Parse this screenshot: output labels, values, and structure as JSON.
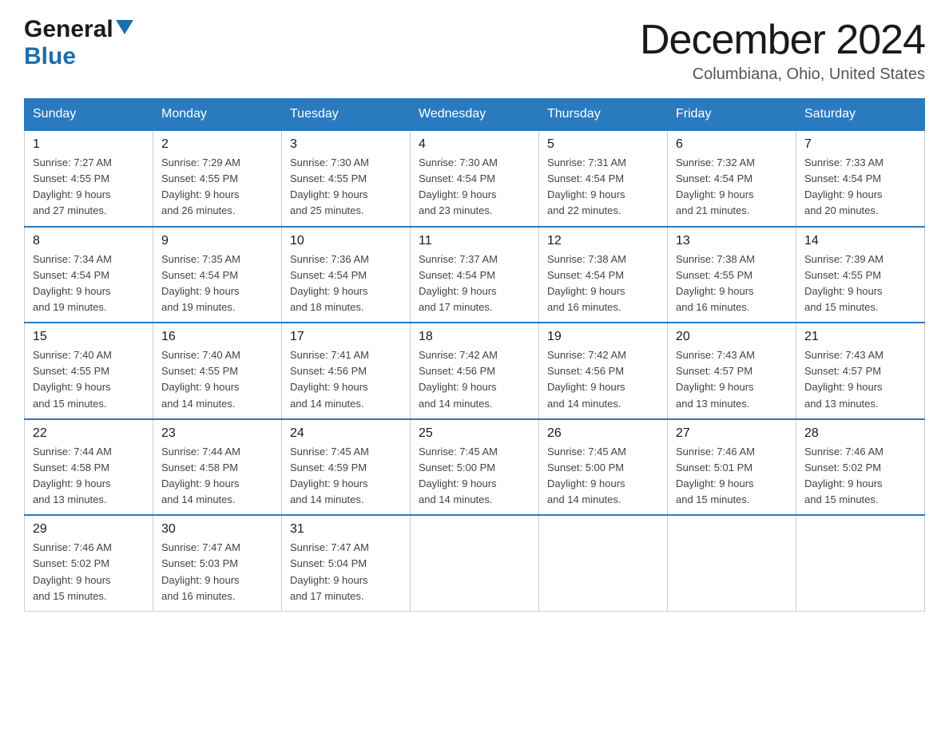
{
  "header": {
    "logo_general": "General",
    "logo_blue": "Blue",
    "month_title": "December 2024",
    "location": "Columbiana, Ohio, United States"
  },
  "days_of_week": [
    "Sunday",
    "Monday",
    "Tuesday",
    "Wednesday",
    "Thursday",
    "Friday",
    "Saturday"
  ],
  "weeks": [
    [
      {
        "num": "1",
        "sunrise": "7:27 AM",
        "sunset": "4:55 PM",
        "daylight": "9 hours and 27 minutes."
      },
      {
        "num": "2",
        "sunrise": "7:29 AM",
        "sunset": "4:55 PM",
        "daylight": "9 hours and 26 minutes."
      },
      {
        "num": "3",
        "sunrise": "7:30 AM",
        "sunset": "4:55 PM",
        "daylight": "9 hours and 25 minutes."
      },
      {
        "num": "4",
        "sunrise": "7:30 AM",
        "sunset": "4:54 PM",
        "daylight": "9 hours and 23 minutes."
      },
      {
        "num": "5",
        "sunrise": "7:31 AM",
        "sunset": "4:54 PM",
        "daylight": "9 hours and 22 minutes."
      },
      {
        "num": "6",
        "sunrise": "7:32 AM",
        "sunset": "4:54 PM",
        "daylight": "9 hours and 21 minutes."
      },
      {
        "num": "7",
        "sunrise": "7:33 AM",
        "sunset": "4:54 PM",
        "daylight": "9 hours and 20 minutes."
      }
    ],
    [
      {
        "num": "8",
        "sunrise": "7:34 AM",
        "sunset": "4:54 PM",
        "daylight": "9 hours and 19 minutes."
      },
      {
        "num": "9",
        "sunrise": "7:35 AM",
        "sunset": "4:54 PM",
        "daylight": "9 hours and 19 minutes."
      },
      {
        "num": "10",
        "sunrise": "7:36 AM",
        "sunset": "4:54 PM",
        "daylight": "9 hours and 18 minutes."
      },
      {
        "num": "11",
        "sunrise": "7:37 AM",
        "sunset": "4:54 PM",
        "daylight": "9 hours and 17 minutes."
      },
      {
        "num": "12",
        "sunrise": "7:38 AM",
        "sunset": "4:54 PM",
        "daylight": "9 hours and 16 minutes."
      },
      {
        "num": "13",
        "sunrise": "7:38 AM",
        "sunset": "4:55 PM",
        "daylight": "9 hours and 16 minutes."
      },
      {
        "num": "14",
        "sunrise": "7:39 AM",
        "sunset": "4:55 PM",
        "daylight": "9 hours and 15 minutes."
      }
    ],
    [
      {
        "num": "15",
        "sunrise": "7:40 AM",
        "sunset": "4:55 PM",
        "daylight": "9 hours and 15 minutes."
      },
      {
        "num": "16",
        "sunrise": "7:40 AM",
        "sunset": "4:55 PM",
        "daylight": "9 hours and 14 minutes."
      },
      {
        "num": "17",
        "sunrise": "7:41 AM",
        "sunset": "4:56 PM",
        "daylight": "9 hours and 14 minutes."
      },
      {
        "num": "18",
        "sunrise": "7:42 AM",
        "sunset": "4:56 PM",
        "daylight": "9 hours and 14 minutes."
      },
      {
        "num": "19",
        "sunrise": "7:42 AM",
        "sunset": "4:56 PM",
        "daylight": "9 hours and 14 minutes."
      },
      {
        "num": "20",
        "sunrise": "7:43 AM",
        "sunset": "4:57 PM",
        "daylight": "9 hours and 13 minutes."
      },
      {
        "num": "21",
        "sunrise": "7:43 AM",
        "sunset": "4:57 PM",
        "daylight": "9 hours and 13 minutes."
      }
    ],
    [
      {
        "num": "22",
        "sunrise": "7:44 AM",
        "sunset": "4:58 PM",
        "daylight": "9 hours and 13 minutes."
      },
      {
        "num": "23",
        "sunrise": "7:44 AM",
        "sunset": "4:58 PM",
        "daylight": "9 hours and 14 minutes."
      },
      {
        "num": "24",
        "sunrise": "7:45 AM",
        "sunset": "4:59 PM",
        "daylight": "9 hours and 14 minutes."
      },
      {
        "num": "25",
        "sunrise": "7:45 AM",
        "sunset": "5:00 PM",
        "daylight": "9 hours and 14 minutes."
      },
      {
        "num": "26",
        "sunrise": "7:45 AM",
        "sunset": "5:00 PM",
        "daylight": "9 hours and 14 minutes."
      },
      {
        "num": "27",
        "sunrise": "7:46 AM",
        "sunset": "5:01 PM",
        "daylight": "9 hours and 15 minutes."
      },
      {
        "num": "28",
        "sunrise": "7:46 AM",
        "sunset": "5:02 PM",
        "daylight": "9 hours and 15 minutes."
      }
    ],
    [
      {
        "num": "29",
        "sunrise": "7:46 AM",
        "sunset": "5:02 PM",
        "daylight": "9 hours and 15 minutes."
      },
      {
        "num": "30",
        "sunrise": "7:47 AM",
        "sunset": "5:03 PM",
        "daylight": "9 hours and 16 minutes."
      },
      {
        "num": "31",
        "sunrise": "7:47 AM",
        "sunset": "5:04 PM",
        "daylight": "9 hours and 17 minutes."
      },
      null,
      null,
      null,
      null
    ]
  ],
  "labels": {
    "sunrise": "Sunrise:",
    "sunset": "Sunset:",
    "daylight": "Daylight:"
  }
}
